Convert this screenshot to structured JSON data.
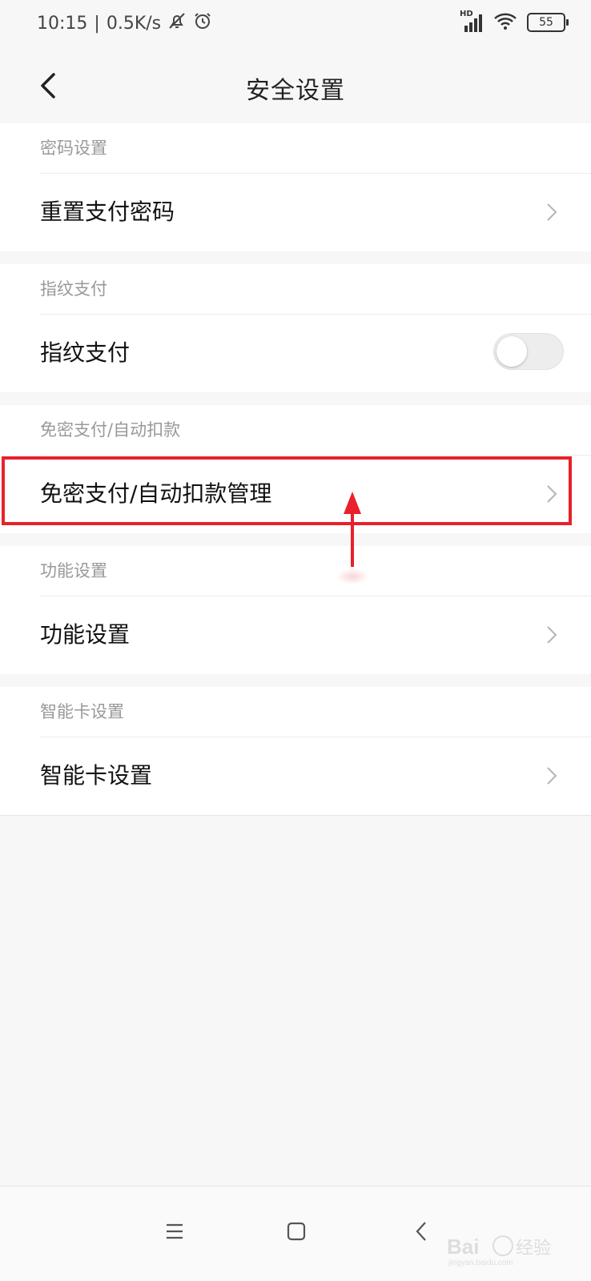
{
  "status": {
    "time": "10:15",
    "separator": "|",
    "speed": "0.5K/s",
    "network": "HD",
    "battery": "55"
  },
  "title": "安全设置",
  "sections": [
    {
      "header": "密码设置",
      "row": "重置支付密码"
    },
    {
      "header": "指纹支付",
      "row": "指纹支付",
      "toggle_on": false
    },
    {
      "header": "免密支付/自动扣款",
      "row": "免密支付/自动扣款管理"
    },
    {
      "header": "功能设置",
      "row": "功能设置"
    },
    {
      "header": "智能卡设置",
      "row": "智能卡设置"
    }
  ],
  "colors": {
    "highlight": "#e8212a"
  },
  "icons": [
    "back-arrow-icon",
    "chevron-right-icon",
    "menu-icon",
    "home-icon",
    "nav-back-icon",
    "mute-bell-icon",
    "alarm-icon",
    "signal-icon",
    "wifi-icon",
    "battery-icon"
  ]
}
